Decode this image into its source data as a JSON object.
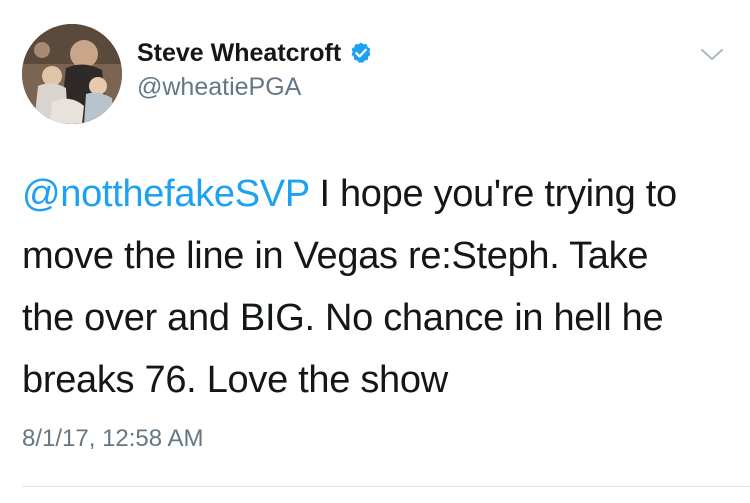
{
  "tweet": {
    "author": {
      "display_name": "Steve Wheatcroft",
      "handle": "@wheatiePGA",
      "verified": true,
      "avatar_icon": "profile-photo"
    },
    "menu_icon": "chevron-down-icon",
    "mention": "@notthefakeSVP",
    "line1_rest": " I hope you're trying to",
    "line2": "move the line in Vegas re:Steph. Take",
    "line3": "the over and BIG. No chance in hell he",
    "line4": "breaks 76. Love the show",
    "timestamp": "8/1/17, 12:58 AM"
  },
  "colors": {
    "link": "#1da1f2",
    "secondary_text": "#657786",
    "primary_text": "#14171a",
    "divider": "#e1e8ed"
  }
}
